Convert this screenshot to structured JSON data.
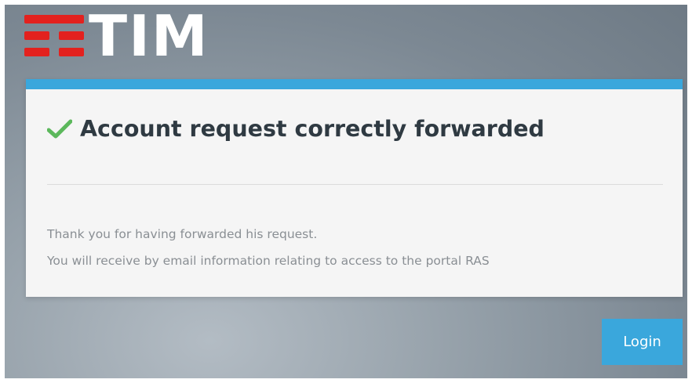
{
  "brand": {
    "name": "TIM",
    "logo_icon": "tim-logo-icon",
    "logo_color": "#e3211e"
  },
  "card": {
    "accent_color": "#3aa7dc",
    "title_icon": "check-icon",
    "title": "Account request correctly forwarded",
    "message_line_1": "Thank you for having forwarded his request.",
    "message_line_2": "You will receive by email information relating to access to the portal RAS"
  },
  "actions": {
    "login_label": "Login"
  }
}
